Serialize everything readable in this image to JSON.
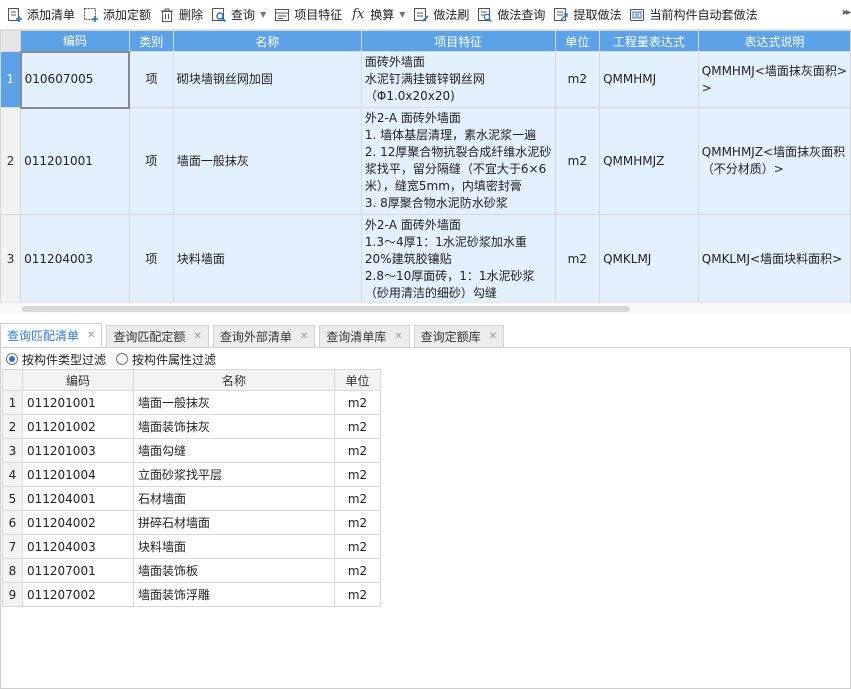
{
  "toolbar": {
    "buttons": [
      {
        "label": "添加清单",
        "icon": "add-list-icon"
      },
      {
        "label": "添加定额",
        "icon": "add-quota-icon"
      },
      {
        "label": "删除",
        "icon": "trash-icon"
      },
      {
        "label": "查询",
        "icon": "query-icon"
      },
      {
        "label": "项目特征",
        "icon": "feature-icon"
      },
      {
        "label": "换算",
        "icon": "fx-icon"
      },
      {
        "label": "做法刷",
        "icon": "brush-icon"
      },
      {
        "label": "做法查询",
        "icon": "method-query-icon"
      },
      {
        "label": "提取做法",
        "icon": "extract-icon"
      },
      {
        "label": "当前构件自动套做法",
        "icon": "auto-apply-icon"
      }
    ],
    "fx_glyph": "fx"
  },
  "upper_grid": {
    "headers": [
      "编码",
      "类别",
      "名称",
      "项目特征",
      "单位",
      "工程量表达式",
      "表达式说明"
    ],
    "rows": [
      {
        "num": "1",
        "code": "010607005",
        "type": "项",
        "name": "砌块墙钢丝网加固",
        "features": [
          "面砖外墙面",
          "水泥钉满挂镀锌钢丝网",
          "（Φ1.0x20x20)"
        ],
        "unit": "m2",
        "expr": "QMMHMJ",
        "desc": [
          "QMMHMJ<墙面抹灰面积>",
          ">"
        ]
      },
      {
        "num": "2",
        "code": "011201001",
        "type": "项",
        "name": "墙面一般抹灰",
        "features": [
          "外2-A 面砖外墙面",
          "1. 墙体基层清理，素水泥浆一遍",
          "2. 12厚聚合物抗裂合成纤维水泥砂浆找平，留分隔缝（不宜大于6×6米），缝宽5mm，内填密封膏",
          "3. 8厚聚合物水泥防水砂浆"
        ],
        "unit": "m2",
        "expr": "QMMHMJZ",
        "desc": [
          "QMMHMJZ<墙面抹灰面积（不分材质）>"
        ]
      },
      {
        "num": "3",
        "code": "011204003",
        "type": "项",
        "name": "块料墙面",
        "features": [
          "外2-A 面砖外墙面",
          "1.3～4厚1：1水泥砂浆加水重20%建筑胶镶贴",
          "2.8～10厚面砖，1：1水泥砂浆（砂用清洁的细砂）勾缝"
        ],
        "unit": "m2",
        "expr": "QMKLMJ",
        "desc": [
          "QMKLMJ<墙面块料面积>"
        ]
      }
    ]
  },
  "tabs": [
    {
      "label": "查询匹配清单",
      "active": true
    },
    {
      "label": "查询匹配定额",
      "active": false
    },
    {
      "label": "查询外部清单",
      "active": false
    },
    {
      "label": "查询清单库",
      "active": false
    },
    {
      "label": "查询定额库",
      "active": false
    }
  ],
  "filters": {
    "by_type": "按构件类型过滤",
    "by_attr": "按构件属性过滤",
    "selected": "by_type"
  },
  "lower_grid": {
    "headers": [
      "编码",
      "名称",
      "单位"
    ],
    "rows": [
      {
        "num": "1",
        "code": "011201001",
        "name": "墙面一般抹灰",
        "unit": "m2"
      },
      {
        "num": "2",
        "code": "011201002",
        "name": "墙面装饰抹灰",
        "unit": "m2"
      },
      {
        "num": "3",
        "code": "011201003",
        "name": "墙面勾缝",
        "unit": "m2"
      },
      {
        "num": "4",
        "code": "011201004",
        "name": "立面砂浆找平层",
        "unit": "m2"
      },
      {
        "num": "5",
        "code": "011204001",
        "name": "石材墙面",
        "unit": "m2"
      },
      {
        "num": "6",
        "code": "011204002",
        "name": "拼碎石材墙面",
        "unit": "m2"
      },
      {
        "num": "7",
        "code": "011204003",
        "name": "块料墙面",
        "unit": "m2"
      },
      {
        "num": "8",
        "code": "011207001",
        "name": "墙面装饰板",
        "unit": "m2"
      },
      {
        "num": "9",
        "code": "011207002",
        "name": "墙面装饰浮雕",
        "unit": "m2"
      }
    ]
  },
  "colors": {
    "accent": "#5ba2e8",
    "row_bg": "#e3f0fd",
    "tab_active": "#2f7bd8"
  }
}
